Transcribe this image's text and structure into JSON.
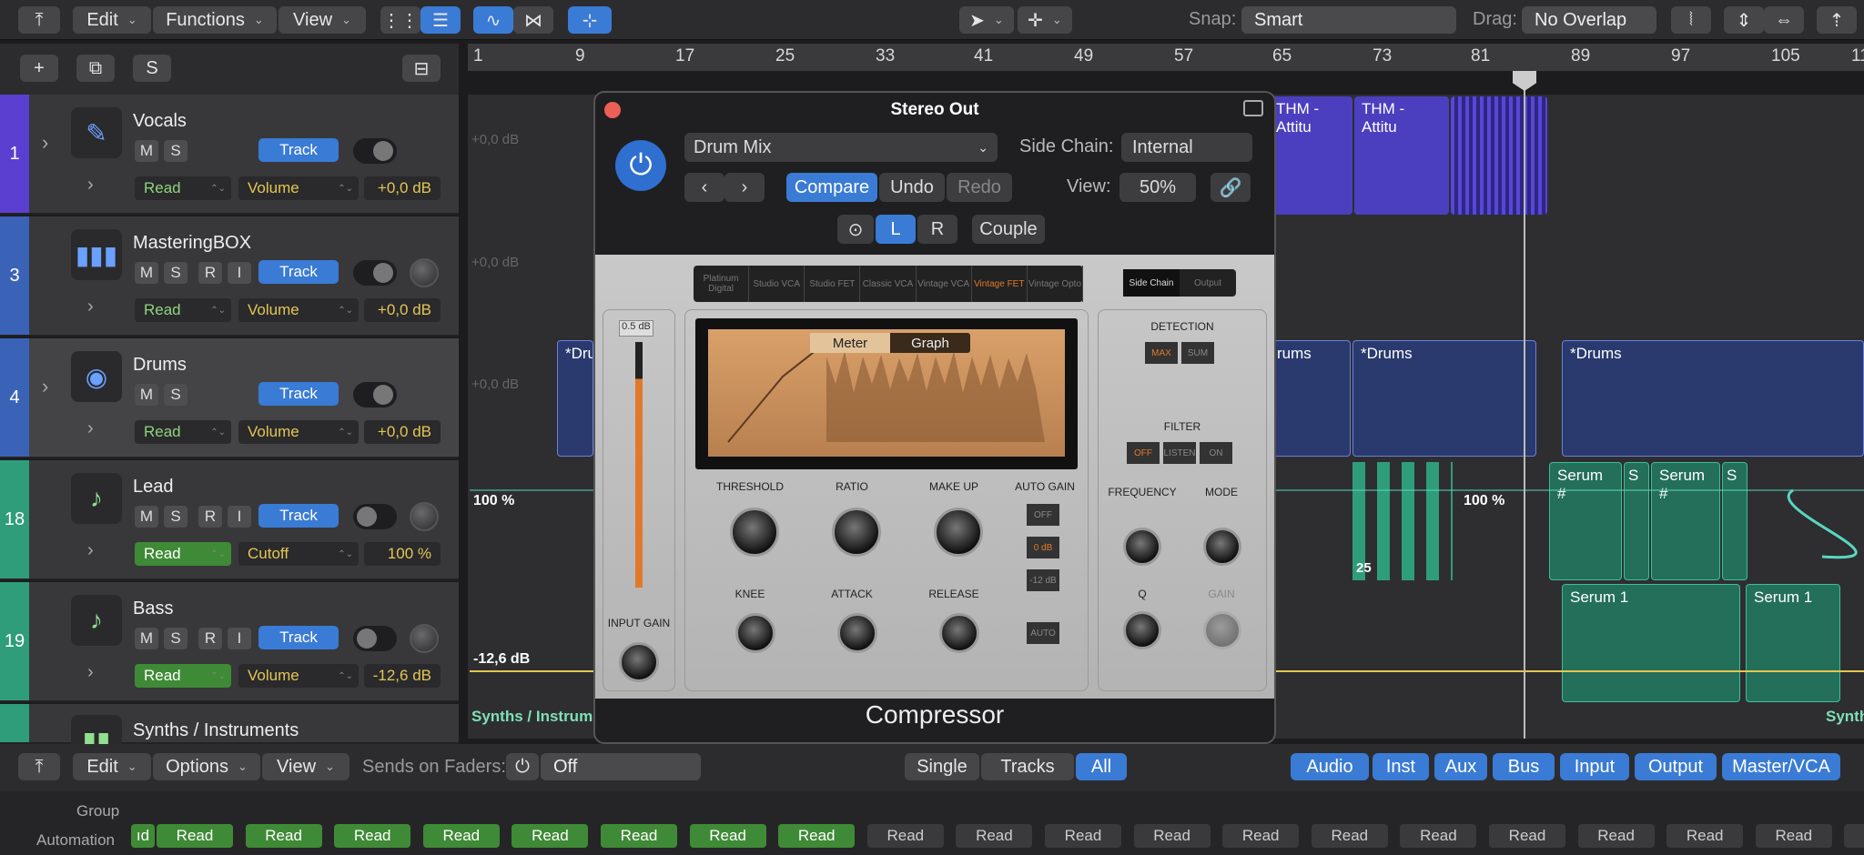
{
  "toolbar": {
    "edit": "Edit",
    "functions": "Functions",
    "view": "View",
    "snap_label": "Snap:",
    "snap_value": "Smart",
    "drag_label": "Drag:",
    "drag_value": "No Overlap"
  },
  "ruler": [
    "1",
    "9",
    "17",
    "25",
    "33",
    "41",
    "49",
    "57",
    "65",
    "73",
    "81",
    "89",
    "97",
    "105",
    "11"
  ],
  "tracks": [
    {
      "num": "1",
      "name": "Vocals",
      "read": "Read",
      "param": "Volume",
      "value": "+0,0 dB",
      "track_btn": "Track",
      "color": "#5b3fd1"
    },
    {
      "num": "3",
      "name": "MasteringBOX",
      "read": "Read",
      "param": "Volume",
      "value": "+0,0 dB",
      "track_btn": "Track",
      "color": "#3a63b8"
    },
    {
      "num": "4",
      "name": "Drums",
      "read": "Read",
      "param": "Volume",
      "value": "+0,0 dB",
      "track_btn": "Track",
      "color": "#3a63b8"
    },
    {
      "num": "18",
      "name": "Lead",
      "read": "Read",
      "param": "Cutoff",
      "value": "100 %",
      "track_btn": "Track",
      "color": "#2f9d7a"
    },
    {
      "num": "19",
      "name": "Bass",
      "read": "Read",
      "param": "Volume",
      "value": "-12,6 dB",
      "track_btn": "Track",
      "color": "#2f9d7a"
    },
    {
      "num": "",
      "name": "Synths / Instruments",
      "color": "#2f9d7a"
    }
  ],
  "track_buttons": {
    "m": "M",
    "s": "S",
    "r": "R",
    "i": "I"
  },
  "arrange": {
    "db1": "+0,0 dB",
    "db2": "+0,0 dB",
    "db3": "+0,0 dB",
    "lead_pct": "100 %",
    "lead_pct2": "100 %",
    "bass_db": "-12,6 dB",
    "synths_label": "Synths / Instrum",
    "synths_right": "Synth",
    "num25": "25",
    "regions": [
      "THM - Attitu",
      "THM - Attitu",
      "*Dru",
      "rums",
      "*Drums",
      "*Drums",
      "Serum #",
      "S",
      "Serum #",
      "S",
      "Serum 1",
      "Serum 1"
    ]
  },
  "plugin": {
    "title": "Stereo Out",
    "preset": "Drum Mix",
    "sidechain_label": "Side Chain:",
    "sidechain_value": "Internal",
    "compare": "Compare",
    "undo": "Undo",
    "redo": "Redo",
    "view_label": "View:",
    "view_value": "50%",
    "l": "L",
    "r": "R",
    "couple": "Couple",
    "name": "Compressor",
    "models": [
      "Platinum Digital",
      "Studio VCA",
      "Studio FET",
      "Classic VCA",
      "Vintage VCA",
      "Vintage FET",
      "Vintage Opto"
    ],
    "sc_tab": "Side Chain",
    "out_tab": "Output",
    "meter_tab": "Meter",
    "graph_tab": "Graph",
    "meter_top": "0.5 dB",
    "knobs": {
      "threshold": "THRESHOLD",
      "ratio": "RATIO",
      "makeup": "MAKE UP",
      "autogain": "AUTO GAIN",
      "knee": "KNEE",
      "attack": "ATTACK",
      "release": "RELEASE",
      "input_gain": "INPUT GAIN",
      "frequency": "FREQUENCY",
      "mode": "MODE",
      "q": "Q",
      "gain": "GAIN"
    },
    "detection": "DETECTION",
    "max": "MAX",
    "sum": "SUM",
    "filter": "FILTER",
    "off": "OFF",
    "listen": "LISTEN",
    "on": "ON",
    "ag_off": "OFF",
    "ag_0": "0 dB",
    "ag_12": "-12 dB",
    "auto": "AUTO"
  },
  "mixer": {
    "edit": "Edit",
    "options": "Options",
    "view": "View",
    "sends_label": "Sends on Faders:",
    "sends_value": "Off",
    "single": "Single",
    "tracks": "Tracks",
    "all": "All",
    "filters": [
      "Audio",
      "Inst",
      "Aux",
      "Bus",
      "Input",
      "Output",
      "Master/VCA"
    ],
    "group": "Group",
    "automation": "Automation",
    "reads": [
      "ıd",
      "Read",
      "Read",
      "Read",
      "Read",
      "Read",
      "Read",
      "Read",
      "Read",
      "Read",
      "Read",
      "Read",
      "Read",
      "Read",
      "Read",
      "Read",
      "Read",
      "Read",
      "Read",
      "Read",
      "Read"
    ]
  }
}
